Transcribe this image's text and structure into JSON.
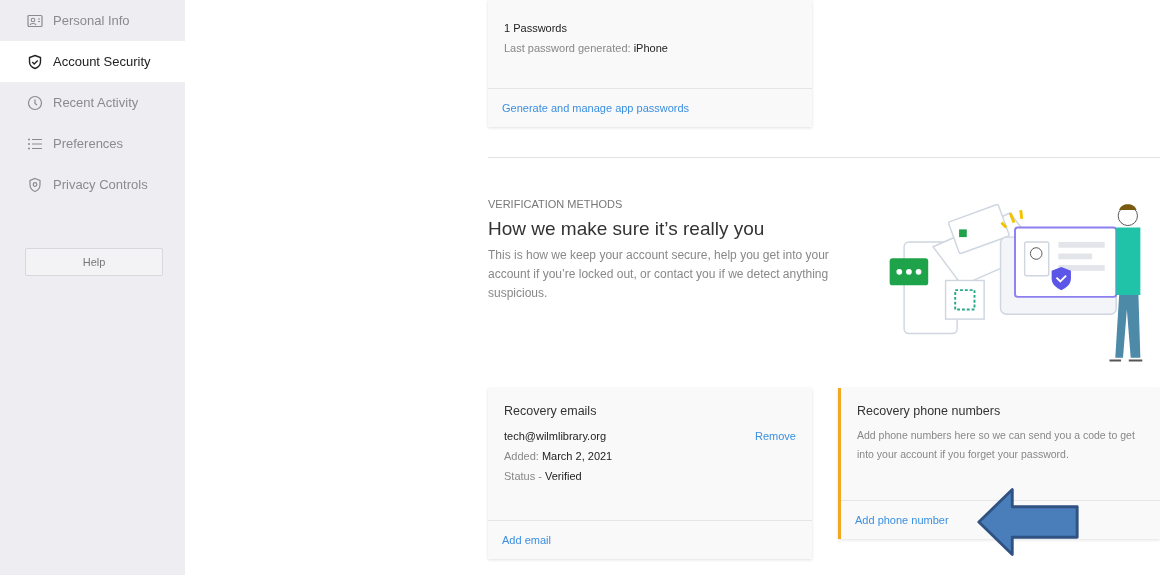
{
  "sidebar": {
    "items": [
      {
        "label": "Personal Info",
        "selected": false
      },
      {
        "label": "Account Security",
        "selected": true
      },
      {
        "label": "Recent Activity",
        "selected": false
      },
      {
        "label": "Preferences",
        "selected": false
      },
      {
        "label": "Privacy Controls",
        "selected": false
      }
    ],
    "help_button": "Help"
  },
  "app_passwords": {
    "count": "1 Passwords",
    "last_generated": "Last password generated: **iPhone**",
    "link": "Generate and manage app passwords"
  },
  "verification": {
    "eyebrow": "VERIFICATION METHODS",
    "title": "How we make sure it’s really you",
    "description": "This is how we keep your account secure, help you get into your account if you’re locked out, or contact you if we detect anything suspicious."
  },
  "recovery_emails": {
    "title": "Recovery emails",
    "email": "tech@wilmlibrary.org",
    "remove": "Remove",
    "added": "Added: **March 2, 2021**",
    "status": "Status - **Verified**",
    "link": "Add email"
  },
  "recovery_phones": {
    "title": "Recovery phone numbers",
    "description": "Add phone numbers here so we can send you a code to get into your account if you forget your password.",
    "link": "Add phone number"
  }
}
